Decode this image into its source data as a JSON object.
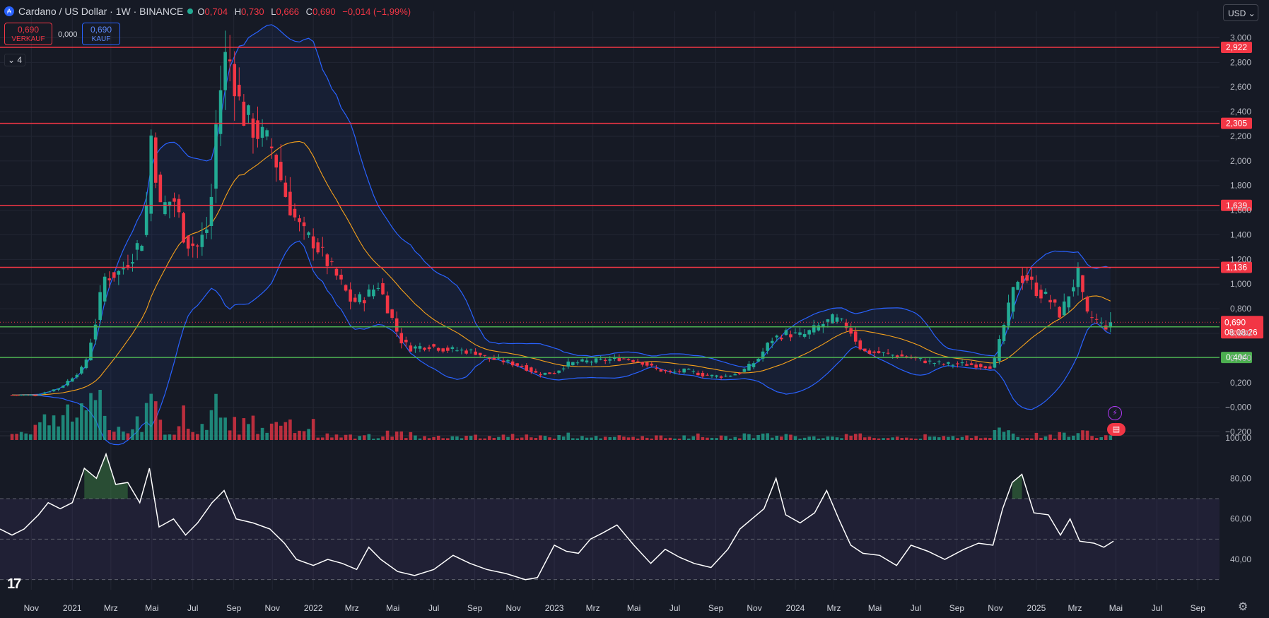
{
  "header": {
    "symbol": "Cardano / US Dollar · 1W · BINANCE",
    "coin_icon": "cardano-icon",
    "ohlc": [
      {
        "k": "O",
        "v": "0,704"
      },
      {
        "k": "H",
        "v": "0,730"
      },
      {
        "k": "L",
        "v": "0,666"
      },
      {
        "k": "C",
        "v": "0,690"
      },
      {
        "k": "",
        "v": "−0,014 (−1,99%)"
      }
    ]
  },
  "trade": {
    "sell_price": "0,690",
    "sell_label": "VERKAUF",
    "spread": "0,000",
    "buy_price": "0,690",
    "buy_label": "KAUF",
    "indicators_count": "4"
  },
  "currency": "USD",
  "colors": {
    "bg": "#161a25",
    "grid": "#222633",
    "up": "#22ab94",
    "down": "#f23645",
    "bb": "#2962ff",
    "ma": "#f7a21b",
    "resistance": "#f23645",
    "support": "#4caf50",
    "rsi": "#ffffff",
    "rsi_band": "#7e57c2"
  },
  "chart_data": {
    "type": "candlestick",
    "price_ticks": [
      "3,000",
      "2,800",
      "2,600",
      "2,400",
      "2,200",
      "2,000",
      "1,800",
      "1,600",
      "1,400",
      "1,200",
      "1,000",
      "0,800",
      "0,600",
      "0,400",
      "0,200",
      "−0,000",
      "−0,200"
    ],
    "price_range": [
      -0.22,
      3.1
    ],
    "time_labels": [
      {
        "label": "Nov",
        "t": 2020.83
      },
      {
        "label": "2021",
        "t": 2021.0
      },
      {
        "label": "Mrz",
        "t": 2021.16
      },
      {
        "label": "Mai",
        "t": 2021.33
      },
      {
        "label": "Jul",
        "t": 2021.5
      },
      {
        "label": "Sep",
        "t": 2021.67
      },
      {
        "label": "Nov",
        "t": 2021.83
      },
      {
        "label": "2022",
        "t": 2022.0
      },
      {
        "label": "Mrz",
        "t": 2022.16
      },
      {
        "label": "Mai",
        "t": 2022.33
      },
      {
        "label": "Jul",
        "t": 2022.5
      },
      {
        "label": "Sep",
        "t": 2022.67
      },
      {
        "label": "Nov",
        "t": 2022.83
      },
      {
        "label": "2023",
        "t": 2023.0
      },
      {
        "label": "Mrz",
        "t": 2023.16
      },
      {
        "label": "Mai",
        "t": 2023.33
      },
      {
        "label": "Jul",
        "t": 2023.5
      },
      {
        "label": "Sep",
        "t": 2023.67
      },
      {
        "label": "Nov",
        "t": 2023.83
      },
      {
        "label": "2024",
        "t": 2024.0
      },
      {
        "label": "Mrz",
        "t": 2024.16
      },
      {
        "label": "Mai",
        "t": 2024.33
      },
      {
        "label": "Jul",
        "t": 2024.5
      },
      {
        "label": "Sep",
        "t": 2024.67
      },
      {
        "label": "Nov",
        "t": 2024.83
      },
      {
        "label": "2025",
        "t": 2025.0
      },
      {
        "label": "Mrz",
        "t": 2025.16
      },
      {
        "label": "Mai",
        "t": 2025.33
      },
      {
        "label": "Jul",
        "t": 2025.5
      },
      {
        "label": "Sep",
        "t": 2025.67
      }
    ],
    "time_range": [
      2020.7,
      2025.76
    ],
    "key_levels": [
      {
        "value": 2.922,
        "label": "2,922",
        "kind": "resistance"
      },
      {
        "value": 2.305,
        "label": "2,305",
        "kind": "resistance"
      },
      {
        "value": 1.639,
        "label": "1,639",
        "kind": "resistance"
      },
      {
        "value": 1.136,
        "label": "1,136",
        "kind": "resistance"
      },
      {
        "value": 0.653,
        "label": "0,653",
        "kind": "support"
      },
      {
        "value": 0.404,
        "label": "0,404",
        "kind": "support"
      }
    ],
    "last_price": {
      "value": 0.69,
      "label": "0,690",
      "countdown": "08:08:26"
    },
    "price_path": [
      [
        2020.75,
        0.1
      ],
      [
        2020.85,
        0.1
      ],
      [
        2020.95,
        0.16
      ],
      [
        2021.05,
        0.33
      ],
      [
        2021.1,
        0.72
      ],
      [
        2021.13,
        1.05
      ],
      [
        2021.2,
        1.1
      ],
      [
        2021.25,
        1.25
      ],
      [
        2021.3,
        1.4
      ],
      [
        2021.33,
        2.3
      ],
      [
        2021.36,
        1.6
      ],
      [
        2021.42,
        1.7
      ],
      [
        2021.47,
        1.35
      ],
      [
        2021.52,
        1.3
      ],
      [
        2021.57,
        1.5
      ],
      [
        2021.6,
        2.4
      ],
      [
        2021.64,
        2.9
      ],
      [
        2021.67,
        2.7
      ],
      [
        2021.7,
        2.4
      ],
      [
        2021.76,
        2.25
      ],
      [
        2021.83,
        2.1
      ],
      [
        2021.88,
        1.75
      ],
      [
        2021.93,
        1.5
      ],
      [
        2021.97,
        1.38
      ],
      [
        2022.0,
        1.35
      ],
      [
        2022.05,
        1.2
      ],
      [
        2022.1,
        1.05
      ],
      [
        2022.16,
        0.85
      ],
      [
        2022.22,
        0.9
      ],
      [
        2022.27,
        1.0
      ],
      [
        2022.32,
        0.75
      ],
      [
        2022.36,
        0.55
      ],
      [
        2022.4,
        0.48
      ],
      [
        2022.48,
        0.5
      ],
      [
        2022.55,
        0.47
      ],
      [
        2022.62,
        0.46
      ],
      [
        2022.67,
        0.45
      ],
      [
        2022.72,
        0.4
      ],
      [
        2022.8,
        0.37
      ],
      [
        2022.87,
        0.33
      ],
      [
        2022.93,
        0.27
      ],
      [
        2023.0,
        0.28
      ],
      [
        2023.05,
        0.35
      ],
      [
        2023.12,
        0.37
      ],
      [
        2023.2,
        0.38
      ],
      [
        2023.28,
        0.4
      ],
      [
        2023.36,
        0.37
      ],
      [
        2023.42,
        0.31
      ],
      [
        2023.48,
        0.28
      ],
      [
        2023.55,
        0.3
      ],
      [
        2023.62,
        0.26
      ],
      [
        2023.7,
        0.25
      ],
      [
        2023.77,
        0.28
      ],
      [
        2023.84,
        0.38
      ],
      [
        2023.9,
        0.55
      ],
      [
        2023.96,
        0.6
      ],
      [
        2024.03,
        0.58
      ],
      [
        2024.1,
        0.66
      ],
      [
        2024.16,
        0.72
      ],
      [
        2024.22,
        0.65
      ],
      [
        2024.28,
        0.45
      ],
      [
        2024.35,
        0.44
      ],
      [
        2024.42,
        0.42
      ],
      [
        2024.48,
        0.4
      ],
      [
        2024.55,
        0.37
      ],
      [
        2024.62,
        0.35
      ],
      [
        2024.7,
        0.35
      ],
      [
        2024.76,
        0.34
      ],
      [
        2024.82,
        0.33
      ],
      [
        2024.87,
        0.7
      ],
      [
        2024.92,
        1.05
      ],
      [
        2024.96,
        1.05
      ],
      [
        2025.0,
        0.95
      ],
      [
        2025.05,
        0.88
      ],
      [
        2025.1,
        0.75
      ],
      [
        2025.14,
        0.95
      ],
      [
        2025.18,
        1.1
      ],
      [
        2025.2,
        0.75
      ],
      [
        2025.24,
        0.72
      ],
      [
        2025.28,
        0.65
      ],
      [
        2025.32,
        0.7
      ]
    ],
    "volume_max": 0.6,
    "rsi": {
      "ticks": [
        "100,00",
        "80,00",
        "60,00",
        "40,00"
      ],
      "range": [
        25,
        100
      ],
      "upper": 70,
      "mid": 50,
      "lower": 30,
      "path": [
        [
          2020.7,
          55
        ],
        [
          2020.75,
          52
        ],
        [
          2020.8,
          55
        ],
        [
          2020.86,
          62
        ],
        [
          2020.9,
          68
        ],
        [
          2020.95,
          65
        ],
        [
          2021.0,
          68
        ],
        [
          2021.05,
          85
        ],
        [
          2021.1,
          80
        ],
        [
          2021.14,
          92
        ],
        [
          2021.18,
          77
        ],
        [
          2021.23,
          78
        ],
        [
          2021.28,
          68
        ],
        [
          2021.32,
          85
        ],
        [
          2021.36,
          56
        ],
        [
          2021.42,
          60
        ],
        [
          2021.47,
          52
        ],
        [
          2021.52,
          58
        ],
        [
          2021.58,
          68
        ],
        [
          2021.63,
          74
        ],
        [
          2021.68,
          60
        ],
        [
          2021.75,
          58
        ],
        [
          2021.82,
          55
        ],
        [
          2021.88,
          48
        ],
        [
          2021.93,
          40
        ],
        [
          2022.0,
          37
        ],
        [
          2022.06,
          40
        ],
        [
          2022.12,
          38
        ],
        [
          2022.18,
          35
        ],
        [
          2022.23,
          46
        ],
        [
          2022.28,
          40
        ],
        [
          2022.35,
          34
        ],
        [
          2022.42,
          32
        ],
        [
          2022.5,
          35
        ],
        [
          2022.58,
          42
        ],
        [
          2022.65,
          38
        ],
        [
          2022.72,
          35
        ],
        [
          2022.8,
          33
        ],
        [
          2022.88,
          30
        ],
        [
          2022.93,
          31
        ],
        [
          2023.0,
          47
        ],
        [
          2023.05,
          44
        ],
        [
          2023.1,
          43
        ],
        [
          2023.15,
          50
        ],
        [
          2023.2,
          53
        ],
        [
          2023.26,
          57
        ],
        [
          2023.33,
          47
        ],
        [
          2023.4,
          38
        ],
        [
          2023.46,
          45
        ],
        [
          2023.52,
          41
        ],
        [
          2023.58,
          38
        ],
        [
          2023.65,
          36
        ],
        [
          2023.72,
          45
        ],
        [
          2023.77,
          55
        ],
        [
          2023.82,
          60
        ],
        [
          2023.87,
          65
        ],
        [
          2023.92,
          80
        ],
        [
          2023.96,
          62
        ],
        [
          2024.02,
          58
        ],
        [
          2024.08,
          63
        ],
        [
          2024.13,
          74
        ],
        [
          2024.18,
          60
        ],
        [
          2024.23,
          47
        ],
        [
          2024.28,
          43
        ],
        [
          2024.35,
          42
        ],
        [
          2024.42,
          37
        ],
        [
          2024.48,
          47
        ],
        [
          2024.55,
          44
        ],
        [
          2024.62,
          40
        ],
        [
          2024.7,
          45
        ],
        [
          2024.76,
          48
        ],
        [
          2024.82,
          47
        ],
        [
          2024.86,
          65
        ],
        [
          2024.9,
          78
        ],
        [
          2024.94,
          82
        ],
        [
          2024.99,
          63
        ],
        [
          2025.05,
          62
        ],
        [
          2025.1,
          52
        ],
        [
          2025.14,
          60
        ],
        [
          2025.18,
          49
        ],
        [
          2025.24,
          48
        ],
        [
          2025.28,
          46
        ],
        [
          2025.32,
          49
        ]
      ]
    }
  }
}
